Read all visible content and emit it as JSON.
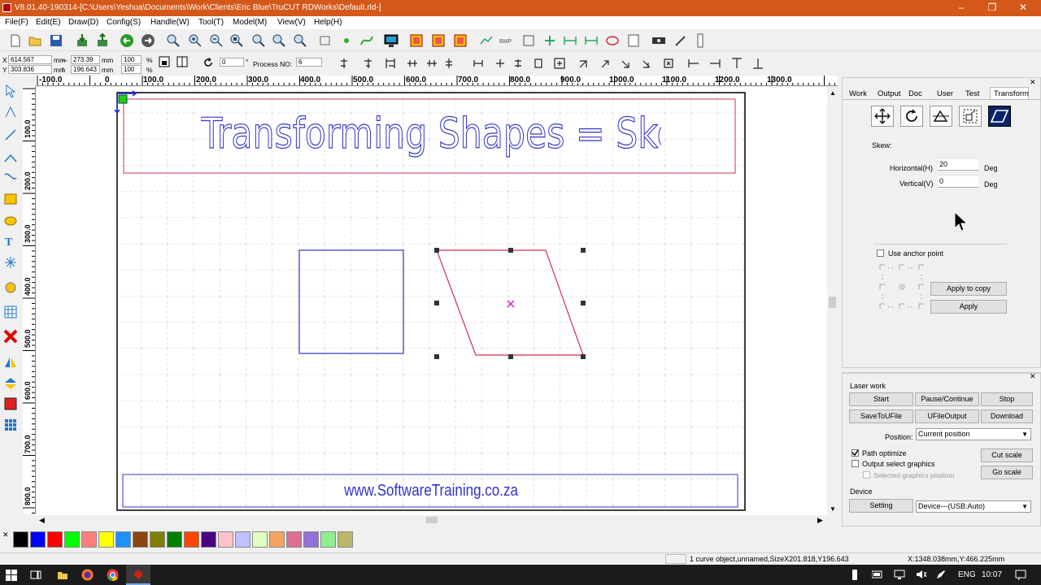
{
  "window": {
    "title": "V8.01.40-190314-[C:\\Users\\Yeshua\\Documents\\Work\\Clients\\Eric Blue\\TruCUT RDWorks\\Default.rld-]"
  },
  "menu": [
    "File(F)",
    "Edit(E)",
    "Draw(D)",
    "Config(S)",
    "Handle(W)",
    "Tool(T)",
    "Model(M)",
    "View(V)",
    "Help(H)"
  ],
  "coords": {
    "x_label": "X",
    "x_value": "614.567",
    "x_unit": "mm",
    "y_label": "Y",
    "y_value": "303.836",
    "y_unit": "mm",
    "w_value": "273.39",
    "w_unit": "mm",
    "h_value": "196.643",
    "h_unit": "mm",
    "sx": "100",
    "sy": "100",
    "pct": "%",
    "rotate": "0",
    "deg": "°",
    "process_label": "Process NO:",
    "process_value": "6"
  },
  "ruler_top": [
    "-100.0",
    "0",
    "100.0",
    "200.0",
    "300.0",
    "400.0",
    "500.0",
    "600.0",
    "700.0",
    "800.0",
    "900.0",
    "1000.0",
    "1100.0",
    "1200.0",
    "1300.0"
  ],
  "ruler_left": [
    "100.0",
    "200.0",
    "300.0",
    "400.0",
    "500.0",
    "600.0",
    "700.0",
    "800.0"
  ],
  "canvas": {
    "heading_text": "Transforming Shapes = Skewing",
    "footer_text": "www.SoftwareTraining.co.za",
    "accent_blue": "#3333cc",
    "accent_red": "#d03050"
  },
  "palette": [
    "#000000",
    "#0000ff",
    "#ff0000",
    "#00ff00",
    "#ff7f7f",
    "#ffff00",
    "#1e90ff",
    "#8b4513",
    "#808000",
    "#008000",
    "#ff4500",
    "#4b0082",
    "#ffc0cb",
    "#c0c0ff",
    "#e0ffc0",
    "#f4a460",
    "#db7093",
    "#9370db",
    "#90ee90",
    "#bdb76b"
  ],
  "status": {
    "object": "1 curve object,unnamed,SizeX201.818,Y196.643",
    "position": "X:1348.038mm,Y:466.225mm"
  },
  "taskbar": {
    "lang": "ENG",
    "time": "10:07"
  },
  "transform_panel": {
    "tabs": [
      "Work",
      "Output",
      "Doc",
      "User",
      "Test",
      "Transform"
    ],
    "skew_label": "Skew:",
    "horizontal_label": "Horizontal(H)",
    "horizontal_value": "20",
    "vertical_label": "Vertical(V)",
    "vertical_value": "0",
    "deg_unit": "Deg",
    "use_anchor_label": "Use anchor point",
    "apply_copy": "Apply to copy",
    "apply": "Apply"
  },
  "laser_panel": {
    "group_label": "Laser work",
    "start": "Start",
    "pause": "Pause/Continue",
    "stop": "Stop",
    "save_u": "SaveToUFile",
    "ufile_output": "UFileOutput",
    "download": "Download",
    "position_label": "Position:",
    "position_value": "Current position",
    "path_optimize": "Path optimize",
    "output_select": "Output select graphics",
    "selected_position": "Selected graphics position",
    "cut_scale": "Cut scale",
    "go_scale": "Go scale",
    "device_group": "Device",
    "setting": "Setting",
    "device_value": "Device---(USB:Auto)"
  }
}
